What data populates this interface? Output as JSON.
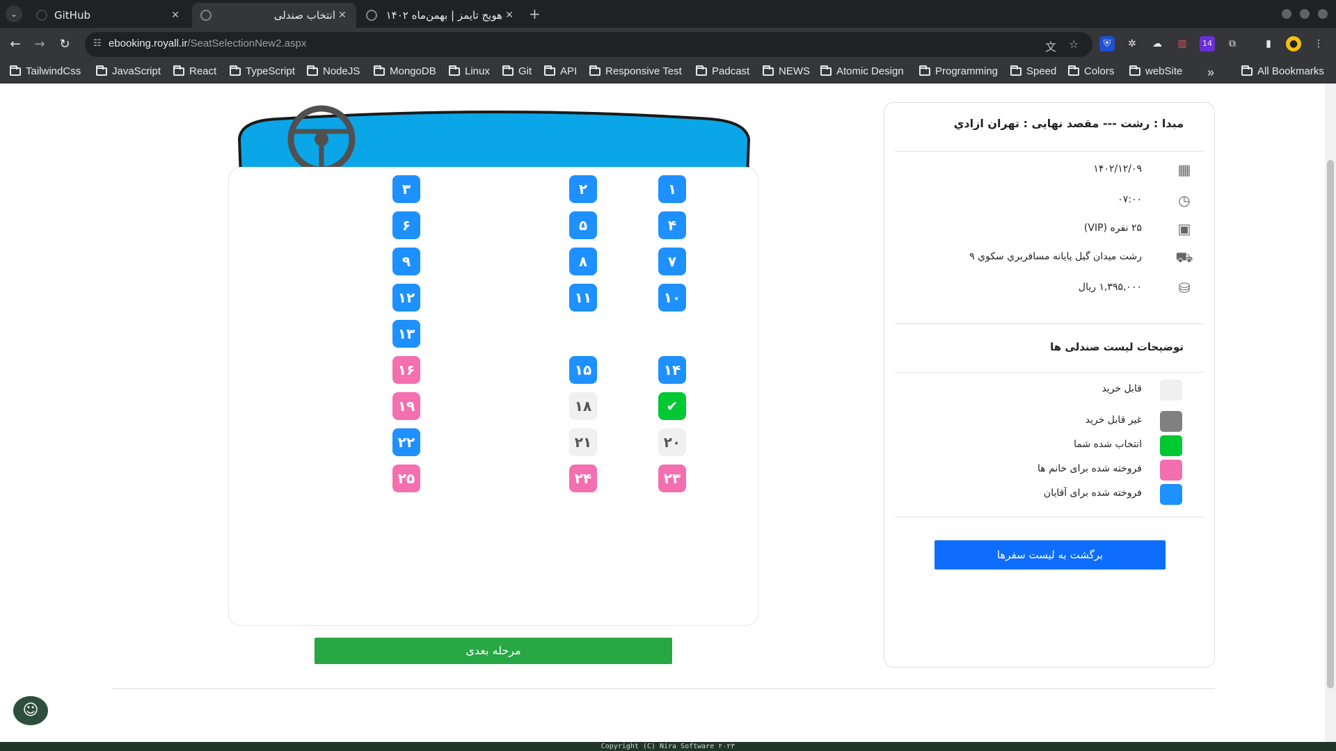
{
  "browser": {
    "tabs": [
      {
        "title": "GitHub",
        "active": false
      },
      {
        "title": "انتخاب صندلی",
        "active": true
      },
      {
        "title": "هویج تایمز | بهمن‌ماه ۱۴۰۲",
        "active": false
      }
    ],
    "url_host": "ebooking.royall.ir",
    "url_path": "/SeatSelectionNew2.aspx",
    "extension_badge": "14",
    "bookmarks": [
      "TailwindCss",
      "JavaScript",
      "React",
      "TypeScript",
      "NodeJS",
      "MongoDB",
      "Linux",
      "Git",
      "API",
      "Responsive Test",
      "Padcast",
      "NEWS",
      "Atomic Design",
      "Programming",
      "Speed",
      "Colors",
      "webSite"
    ],
    "all_bookmarks": "All Bookmarks",
    "more_bookmarks": "»"
  },
  "trip": {
    "route": "مبدا : رشت --- مقصد نهایی : تهران ازادي",
    "date": "۱۴۰۲/۱۲/۰۹",
    "time": "۰۷:۰۰",
    "bus": "۲۵ نفره (VIP)",
    "terminal": "رشت ميدان گيل پايانه مسافربري سکوي ۹",
    "price": "۱,۳۹۵,۰۰۰ ریال"
  },
  "legend": {
    "title": "توضیحات لیست صندلی ها",
    "items": [
      {
        "label": "قابل خرید",
        "color": "#f0f0f0"
      },
      {
        "label": "غیر قابل خرید",
        "color": "#808080"
      },
      {
        "label": "انتخاب شده شما",
        "color": "#00c832"
      },
      {
        "label": "فروخته شده برای خانم ها",
        "color": "#f46fb0"
      },
      {
        "label": "فروخته شده برای آقایان",
        "color": "#1e90ff"
      }
    ]
  },
  "buttons": {
    "back": "برگشت به لیست سفرها",
    "next": "مرحله بعدی"
  },
  "seat_colors": {
    "male": "#1e90ff",
    "female": "#f46fb0",
    "available": "#f0f0f0",
    "selected": "#00c832"
  },
  "seats": [
    {
      "label": "۱",
      "status": "male"
    },
    {
      "label": "۲",
      "status": "male"
    },
    {
      "label": "۳",
      "status": "male"
    },
    {
      "label": "۴",
      "status": "male"
    },
    {
      "label": "۵",
      "status": "male"
    },
    {
      "label": "۶",
      "status": "male"
    },
    {
      "label": "۷",
      "status": "male"
    },
    {
      "label": "۸",
      "status": "male"
    },
    {
      "label": "۹",
      "status": "male"
    },
    {
      "label": "۱۰",
      "status": "male"
    },
    {
      "label": "۱۱",
      "status": "male"
    },
    {
      "label": "۱۲",
      "status": "male"
    },
    {
      "label": "۱۳",
      "status": "male"
    },
    {
      "label": "۱۴",
      "status": "male"
    },
    {
      "label": "۱۵",
      "status": "male"
    },
    {
      "label": "۱۶",
      "status": "female"
    },
    {
      "label": "✔",
      "status": "selected"
    },
    {
      "label": "۱۸",
      "status": "available"
    },
    {
      "label": "۱۹",
      "status": "female"
    },
    {
      "label": "۲۰",
      "status": "available"
    },
    {
      "label": "۲۱",
      "status": "available"
    },
    {
      "label": "۲۲",
      "status": "male"
    },
    {
      "label": "۲۳",
      "status": "female"
    },
    {
      "label": "۲۴",
      "status": "female"
    },
    {
      "label": "۲۵",
      "status": "female"
    }
  ],
  "footer": "Copyright (C) Nira Software ۲۰۲۳"
}
